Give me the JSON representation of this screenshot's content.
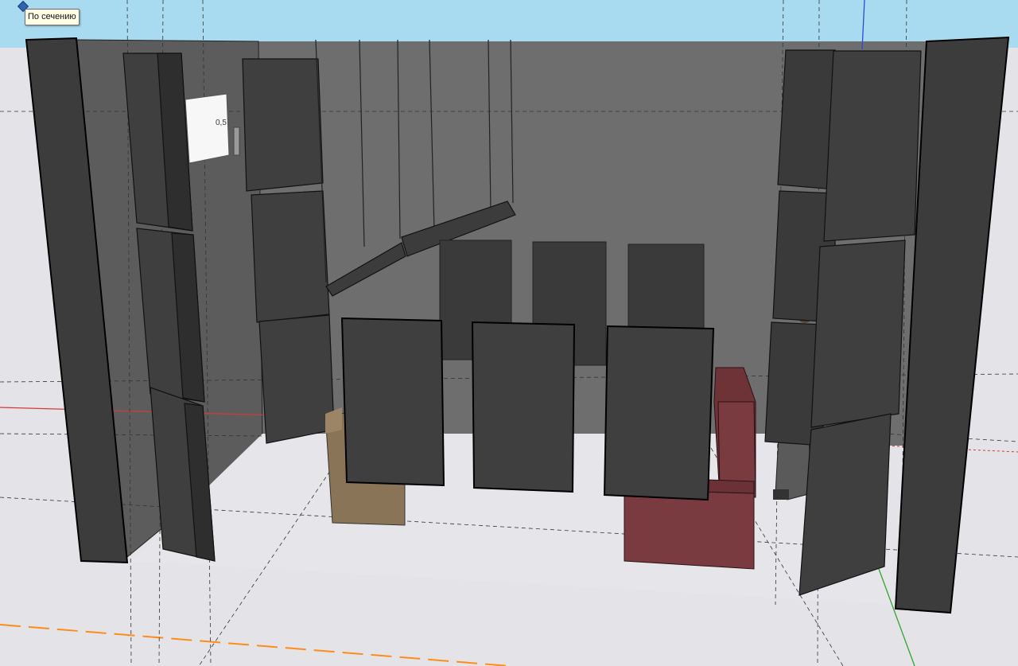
{
  "tooltip": {
    "text": "По сечению"
  },
  "dimension_label": "0,5",
  "icons": {
    "tool_marker": "section-plane-marker-icon"
  },
  "colors": {
    "sky": "#a9dbf0",
    "ground": "#e4e4e8",
    "wall_back": "#6e6e6e",
    "wall_left": "#5e5e5e",
    "panel": "#3f3f3f",
    "panel_side": "#2f2f2f",
    "sofa": "#7a3b40",
    "desk": "#8a7458",
    "window": "#f7f7f7",
    "axis_red": "#d23a3a",
    "axis_green": "#2ea52e",
    "axis_blue": "#2e49d6",
    "axis_orange": "#ff8c1a"
  }
}
